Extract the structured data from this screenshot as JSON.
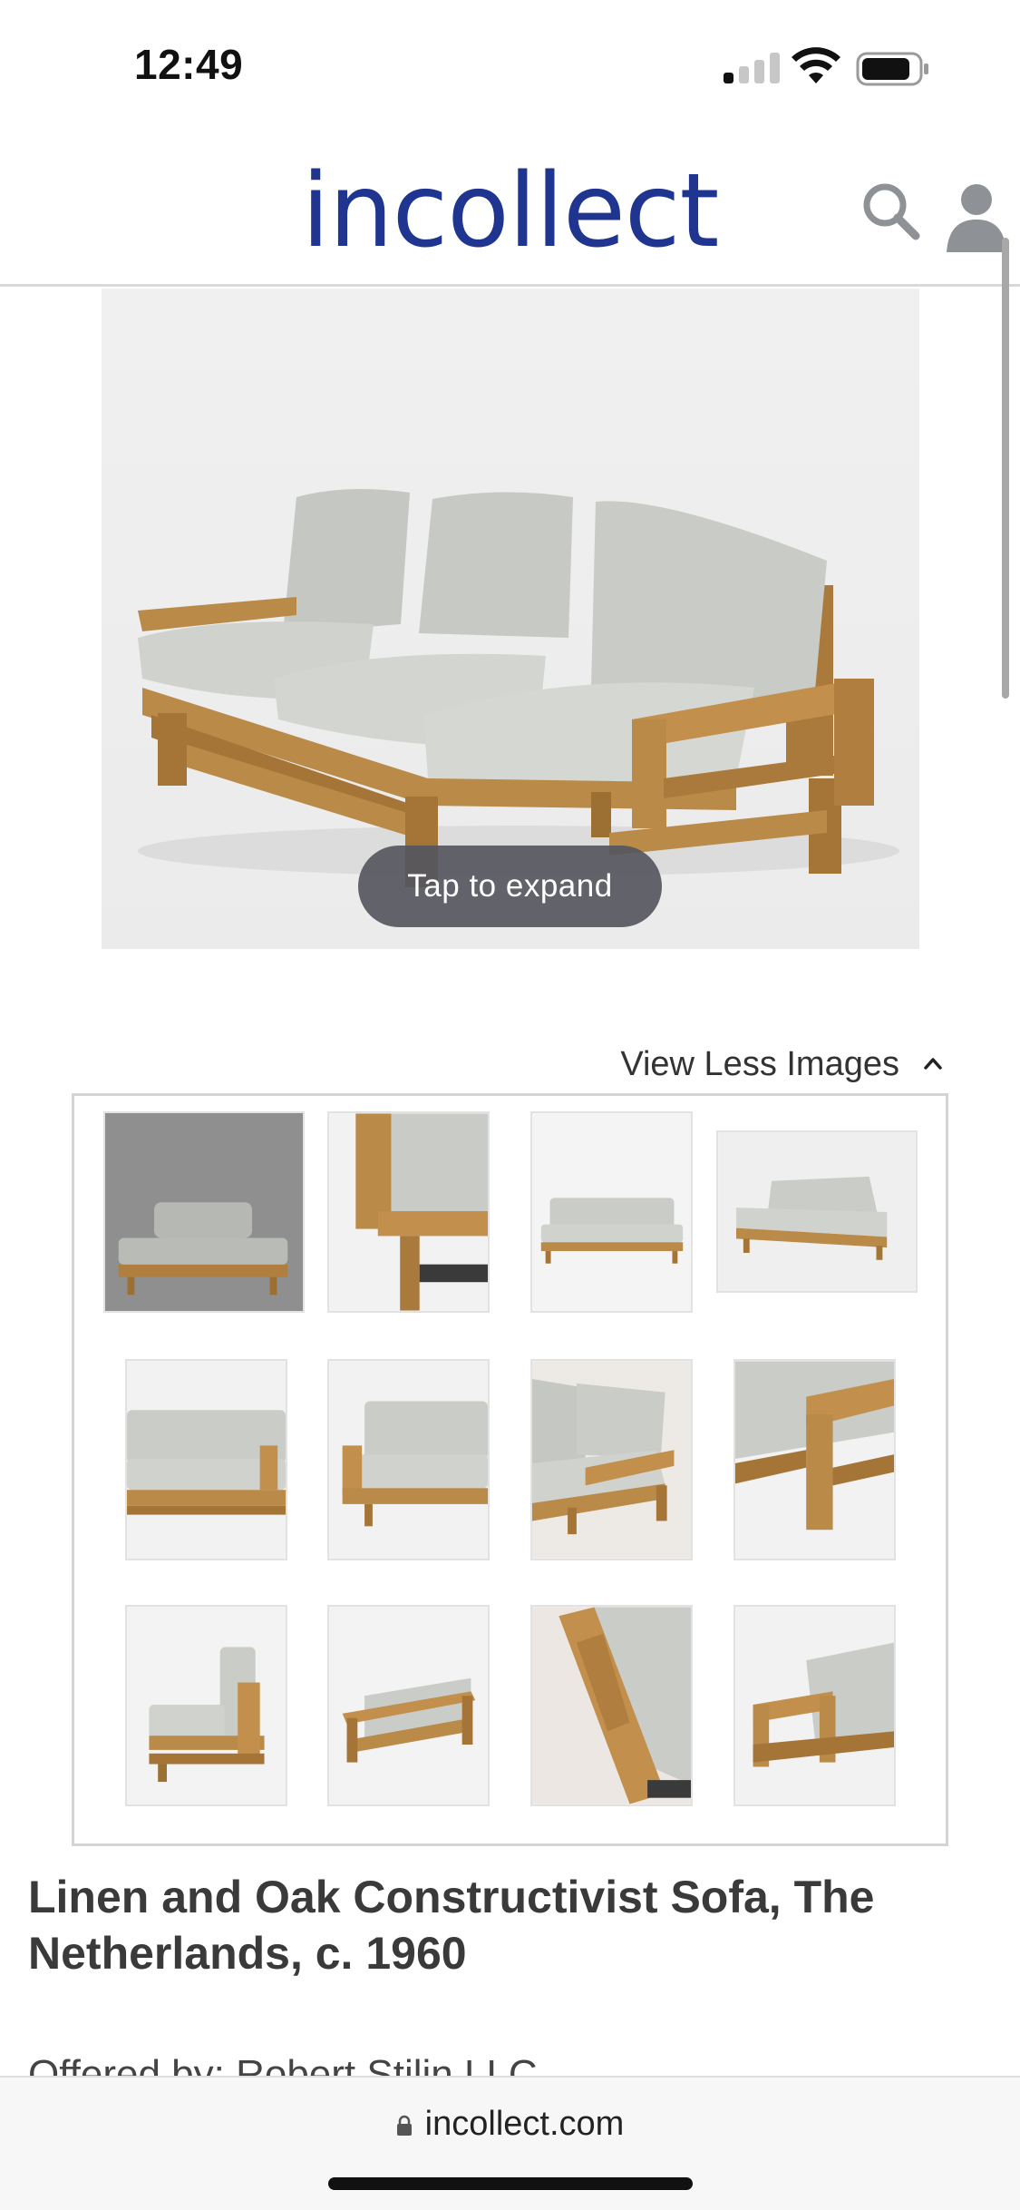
{
  "status_bar": {
    "time": "12:49"
  },
  "header": {
    "logo": "incollect"
  },
  "hero": {
    "tap_label": "Tap to expand"
  },
  "gallery": {
    "toggle_label": "View Less Images"
  },
  "product": {
    "title": "Linen and Oak Constructivist Sofa, The Netherlands, c. 1960",
    "offered_by": "Offered by: Robert Stilin LLC"
  },
  "browser": {
    "url": "incollect.com"
  },
  "colors": {
    "brand": "#1f3590",
    "cushion": "#c9ccc7",
    "oak": "#b98a48",
    "pill": "#55565e"
  }
}
